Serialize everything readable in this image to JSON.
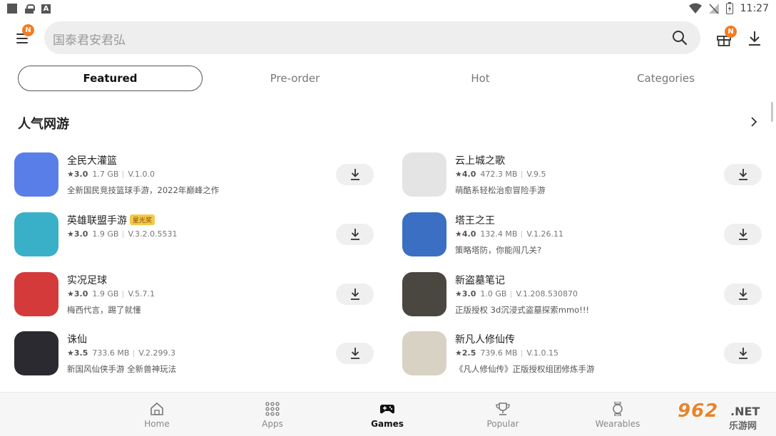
{
  "status_bar": {
    "time": "11:27"
  },
  "header": {
    "menu_badge": "N",
    "search_placeholder": "国泰君安君弘",
    "gift_badge": "N"
  },
  "tabs": [
    {
      "label": "Featured",
      "active": true
    },
    {
      "label": "Pre-order",
      "active": false
    },
    {
      "label": "Hot",
      "active": false
    },
    {
      "label": "Categories",
      "active": false
    }
  ],
  "section": {
    "title": "人气网游"
  },
  "apps": [
    {
      "name": "全民大灌篮",
      "tag": "",
      "rating": "3.0",
      "size": "1.7 GB",
      "version": "V.1.0.0",
      "desc": "全新国民竞技篮球手游，2022年巅峰之作",
      "icon": "basketball-game-icon",
      "color": "#5a7ee8"
    },
    {
      "name": "云上城之歌",
      "tag": "",
      "rating": "4.0",
      "size": "472.3 MB",
      "version": "V.9.5",
      "desc": "萌酷系轻松治愈冒险手游",
      "icon": "placeholder-icon",
      "color": "#e4e4e4"
    },
    {
      "name": "英雄联盟手游",
      "tag": "星光奖",
      "rating": "3.0",
      "size": "1.9 GB",
      "version": "V.3.2.0.5531",
      "desc": "",
      "icon": "lol-game-icon",
      "color": "#3ab0c8"
    },
    {
      "name": "塔王之王",
      "tag": "",
      "rating": "4.0",
      "size": "132.4 MB",
      "version": "V.1.26.11",
      "desc": "策略塔防，你能闯几关?",
      "icon": "tower-game-icon",
      "color": "#3a6fc4"
    },
    {
      "name": "实况足球",
      "tag": "",
      "rating": "3.0",
      "size": "1.9 GB",
      "version": "V.5.7.1",
      "desc": "梅西代言，踢了就懂",
      "icon": "efootball-game-icon",
      "color": "#d43a3a"
    },
    {
      "name": "新盗墓笔记",
      "tag": "",
      "rating": "3.0",
      "size": "1.0 GB",
      "version": "V.1.208.530870",
      "desc": "正版授权 3d沉浸式盗墓探索mmo!!!",
      "icon": "tomb-game-icon",
      "color": "#4a4640"
    },
    {
      "name": "诛仙",
      "tag": "",
      "rating": "3.5",
      "size": "733.6 MB",
      "version": "V.2.299.3",
      "desc": "新国风仙侠手游 全新兽神玩法",
      "icon": "zhuxian-game-icon",
      "color": "#2a2a30"
    },
    {
      "name": "新凡人修仙传",
      "tag": "",
      "rating": "2.5",
      "size": "739.6 MB",
      "version": "V.1.0.15",
      "desc": "《凡人修仙传》正版授权组团修炼手游",
      "icon": "fanren-game-icon",
      "color": "#d8d2c4"
    }
  ],
  "bottom_nav": [
    {
      "label": "Home",
      "icon": "home-icon",
      "active": false
    },
    {
      "label": "Apps",
      "icon": "apps-grid-icon",
      "active": false
    },
    {
      "label": "Games",
      "icon": "gamepad-icon",
      "active": true
    },
    {
      "label": "Popular",
      "icon": "trophy-icon",
      "active": false
    },
    {
      "label": "Wearables",
      "icon": "watch-icon",
      "active": false
    }
  ],
  "watermark": {
    "top": "962",
    "net": ".NET",
    "bottom": "乐游网"
  }
}
